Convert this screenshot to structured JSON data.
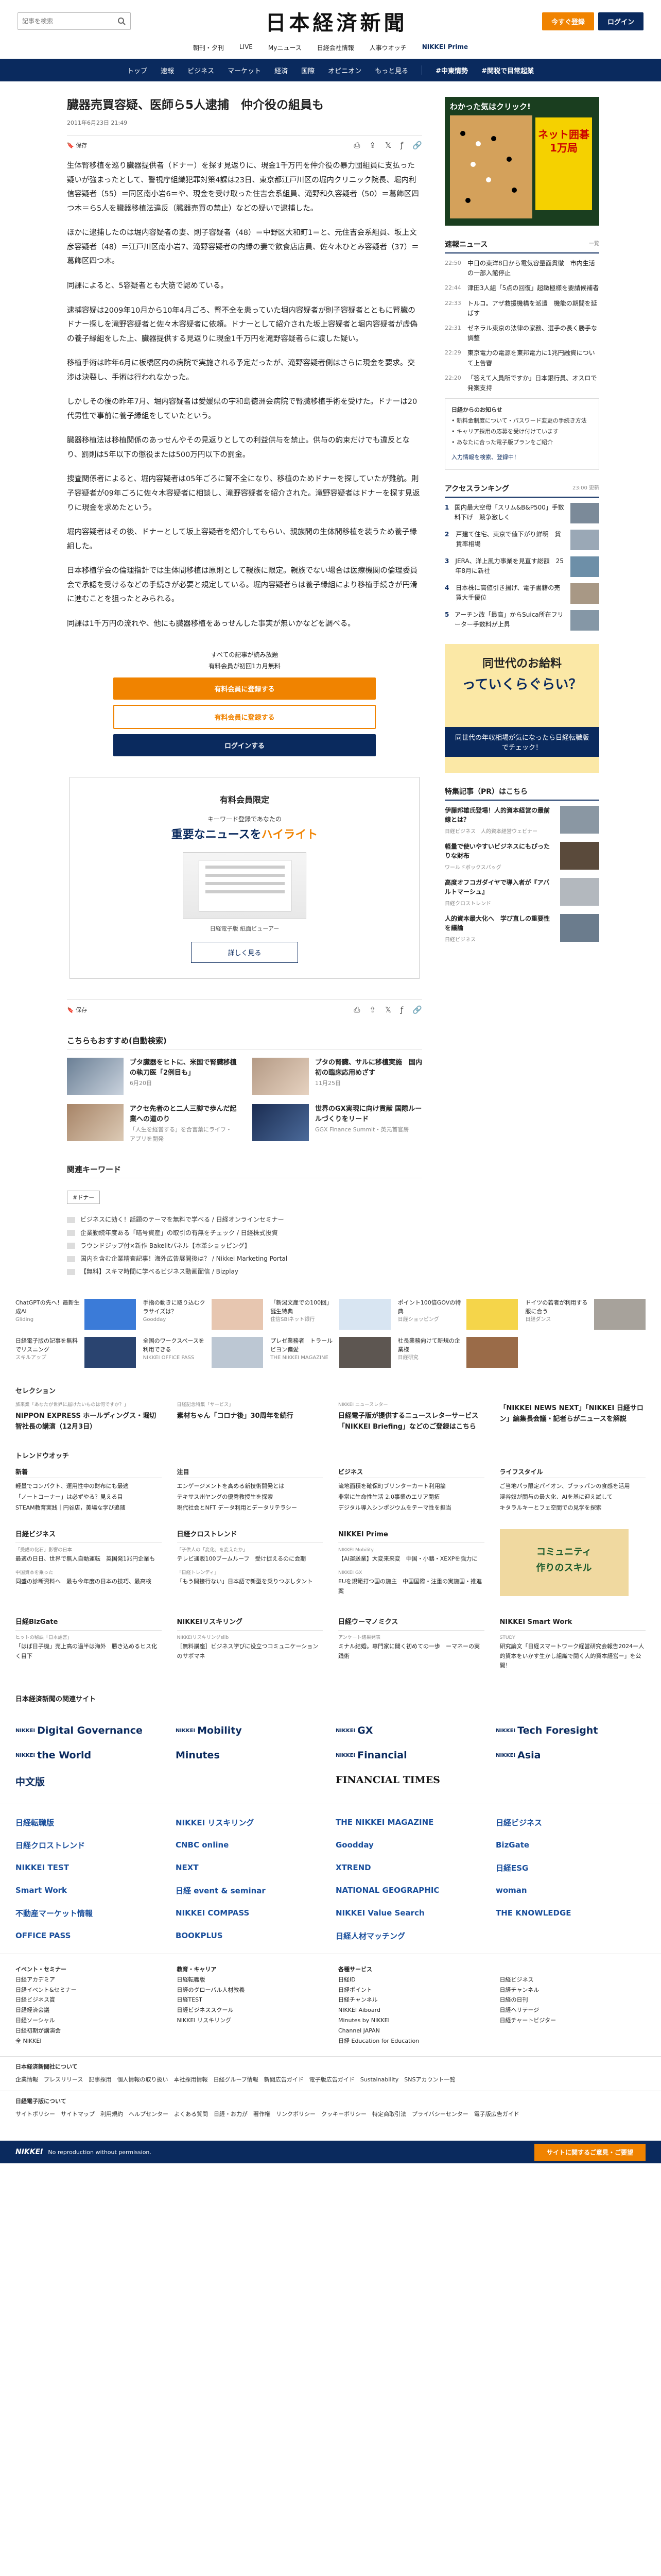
{
  "header": {
    "logo": "日本経済新聞",
    "search_placeholder": "記事を検索",
    "signup": "今すぐ登録",
    "login": "ログイン"
  },
  "subnav": [
    "朝刊・夕刊",
    "LIVE",
    "Myニュース",
    "日経会社情報",
    "人事ウオッチ",
    "NIKKEI Prime"
  ],
  "mainnav": [
    "トップ",
    "速報",
    "ビジネス",
    "マーケット",
    "経済",
    "国際",
    "オピニオン",
    "もっと見る",
    "#中東情勢",
    "#関税で目常起業"
  ],
  "article": {
    "title": "臓器売買容疑、医師ら5人逮捕　仲介役の組員も",
    "date": "2011年6月23日 21:49",
    "save": "保存",
    "paragraphs": [
      "生体腎移植を巡り臓器提供者（ドナー）を探す見返りに、現金1千万円を仲介役の暴力団組員に支払った疑いが強まったとして、警視庁組織犯罪対策4課は23日、東京都江戸川区の堀内クリニック院長、堀内利信容疑者（55）＝同区南小岩6＝や、現金を受け取った住吉会系組員、滝野和久容疑者（50）＝葛飾区四つ木＝ら5人を臓器移植法違反（臓器売買の禁止）などの疑いで逮捕した。",
      "ほかに逮捕したのは堀内容疑者の妻、則子容疑者（48）＝中野区大和町1＝と、元住吉会系組員、坂上文彦容疑者（48）＝江戸川区南小岩7、滝野容疑者の内縁の妻で飲食店店員、佐々木ひとみ容疑者（37）＝葛飾区四つ木。",
      "同課によると、5容疑者とも大筋で認めている。",
      "逮捕容疑は2009年10月から10年4月ごろ、腎不全を患っていた堀内容疑者が則子容疑者とともに腎臓のドナー探しを滝野容疑者と佐々木容疑者に依頼。ドナーとして紹介された坂上容疑者と堀内容疑者が虚偽の養子縁組をした上、臓器提供する見返りに現金1千万円を滝野容疑者らに渡した疑い。",
      "移植手術は昨年6月に板橋区内の病院で実施される予定だったが、滝野容疑者側はさらに現金を要求。交渉は決裂し、手術は行われなかった。",
      "しかしその後の昨年7月、堀内容疑者は愛媛県の宇和島徳洲会病院で腎臓移植手術を受けた。ドナーは20代男性で事前に養子縁組をしていたという。",
      "臓器移植法は移植関係のあっせんやその見返りとしての利益供与を禁止。供与の約束だけでも違反となり、罰則は5年以下の懲役または500万円以下の罰金。",
      "捜査関係者によると、堀内容疑者は05年ごろに腎不全になり、移植のためドナーを探していたが難航。則子容疑者が09年ごろに佐々木容疑者に相談し、滝野容疑者を紹介された。滝野容疑者はドナーを探す見返りに現金を求めたという。",
      "堀内容疑者はその後、ドナーとして坂上容疑者を紹介してもらい、親族間の生体間移植を装うため養子縁組した。",
      "日本移植学会の倫理指針では生体間移植は原則として親族に限定。親族でない場合は医療機関の倫理委員会で承認を受けるなどの手続きが必要と規定している。堀内容疑者らは養子縁組により移植手続きが円滑に進むことを狙ったとみられる。",
      "同課は1千万円の流れや、他にも臓器移植をあっせんした事実が無いかなどを調べる。"
    ]
  },
  "paywall": {
    "note1": "すべての記事が読み放題",
    "note2": "有料会員が初回1カ月無料",
    "btn1": "有料会員に登録する",
    "btn2": "有料会員に登録する",
    "btn3": "ログインする"
  },
  "member": {
    "title": "有料会員限定",
    "kw": "キーワード登録であなたの",
    "big1": "重要なニュースを",
    "big2": "ハイライト",
    "cap": "日経電子版 紙面ビューアー",
    "more": "詳しく見る"
  },
  "reco": {
    "title": "こちらもおすすめ(自動検索)",
    "items": [
      {
        "t": "ブタ臓器をヒトに、米国で腎臓移植の執刀医「2例目も」",
        "d": "6月20日"
      },
      {
        "t": "ブタの腎臓、サルに移植実施　国内初の臨床応用めざす",
        "d": "11月25日"
      },
      {
        "t": "アクセ先者のと二人三脚で歩んだ起業への道のり",
        "d": "「人生を経営する」を合言葉にライフ・アプリを開発"
      },
      {
        "t": "世界のGX実現に向け貢献 国際ルールづくりをリード",
        "d": "GGX Finance Summit・英元首官房"
      }
    ]
  },
  "keywords": {
    "title": "関連キーワード",
    "tag": "#ドナー",
    "ads": [
      "ビジネスに効く！話題のテーマを無料で学べる / 日経オンラインセミナー",
      "企業勤続年度ある「暗号資産」の取引の有無をチェック / 日経株式投資",
      "ラウンドジップ付×新作 Bakelitパネル【本革ショッピング】",
      "国内を含む企業精査記事！海外広告展開後は？ / Nikkei Marketing Portal",
      "【無料】スキマ時間に学べるビジネス動画配信 / Bizplay"
    ]
  },
  "sidebar": {
    "ad1_title": "わかった気はクリック!",
    "ad1_badge": "ネット囲碁1万局",
    "breaking_title": "速報ニュース",
    "breaking_more": "一覧",
    "breaking": [
      {
        "tm": "22:50",
        "t": "中日の東洋8日から電気容量面貫徹　市内生活の一部入館停止"
      },
      {
        "tm": "22:44",
        "t": "津田3人組「5点の回復」超緻極様を要請候補者"
      },
      {
        "tm": "22:33",
        "t": "トルコ。アザ救援機構を派遣　機能の期間を延ばす"
      },
      {
        "tm": "22:31",
        "t": "ゼネラル東京の法律の家務、選手の長く勝手な調整"
      },
      {
        "tm": "22:29",
        "t": "東京電力の電源を東邦電力に1兆円融資について上告審"
      },
      {
        "tm": "22:20",
        "t": "「答えて人員所ですか」日本銀行員、オスロで発案支持"
      }
    ],
    "alert_title": "日経からのお知らせ",
    "alerts": [
      "新料金制度について・パスワード変更の手続き方法",
      "キャリア採用の応募を受け付けています",
      "あなたに合った電子版プランをご紹介"
    ],
    "alert_link": "入力情報を検索、登録中！",
    "rank_title": "アクセスランキング",
    "rank_time": "23:00 更新",
    "ranks": [
      "国内最大空母「スリム&B&P500」手数料下げ　競争激しく",
      "戸建て住宅、東京で値下がり鮮明　貸賃率相場",
      "JERA、洋上風力事業を見直す総額　25年8月に新社",
      "日本株に高値引き揚げ、電子書籍の売買大手優位",
      "アーチン改「最高」からSuica所在フリーター手数料が上昇"
    ],
    "ad2_a": "同世代のお給料",
    "ad2_b": "っていくらぐらい？",
    "ad2_c": "同世代の年収相場が気になったら日経転職版でチェック！",
    "pr_title": "特集記事（PR）はこちら",
    "pr": [
      {
        "t": "伊藤邦雄氏登場！人的資本経営の最前線とは？",
        "s": "日経ビジネス　人的資本経営ウェビナー"
      },
      {
        "t": "軽量で使いやすいビジネスにもぴったりな財布",
        "s": "ワールドボックスバッグ"
      },
      {
        "t": "高度オフコガダイヤで導入者が『アバルトマーシュ』",
        "s": "日経クロストレンド"
      },
      {
        "t": "人的資本最大化へ　学び直しの重要性を議論",
        "s": "日経ビジネス"
      }
    ]
  },
  "adstrip": [
    {
      "t": "ChatGPTの先へ！最新生成AI",
      "s": "Gliding"
    },
    {
      "t": "手指の動きに取り込むクラサイズは？",
      "s": "Goodday"
    },
    {
      "t": "「新潟文産での100回」誕生特典",
      "s": "住信SBIネット銀行"
    },
    {
      "t": "ポイント100倍GOVの特典",
      "s": "日経ショッピング"
    },
    {
      "t": "ドイツの若者が利用する服に合う",
      "s": "日経ダンス"
    },
    {
      "t": "日経電子版の記事を無料でリスニング",
      "s": "スキルアップ"
    },
    {
      "t": "全国のワークスペースを利用できる",
      "s": "NIKKEI OFFICE PASS"
    },
    {
      "t": "プレゼ業務者　トラールビヨン偏愛",
      "s": "THE NIKKEI MAGAZINE"
    },
    {
      "t": "社長業務向けて新規の企業様",
      "s": "日経研究"
    },
    {
      "t": "",
      "s": ""
    }
  ],
  "selection": {
    "title": "セレクション",
    "items": [
      {
        "s": "旅来業「あなたが世界に届けたいものは何ですか？」",
        "t": "NIPPON EXPRESS ホールディングス・堀切智社長の講演（12月3日）"
      },
      {
        "s": "日経記念特集「サービス」",
        "t": "素材ちゃん「コロナ後」30周年を続行"
      },
      {
        "s": "NIKKEI ニュースレター",
        "t": "日経電子版が提供するニュースレターサービス「NIKKEI Briefing」などのご登録はこちら"
      },
      {
        "s": "",
        "t": "「NIKKEI NEWS NEXT」「NIKKEI 日経サロン」編集長会議・記者らがニュースを解説"
      }
    ]
  },
  "trend": {
    "title": "トレンドウオッチ",
    "cols": [
      {
        "h": "新着",
        "items": [
          "軽量でコンパクト、運用性中の財布にも最適",
          "「ノートコーナー」は必ずやる？見える目",
          "STEAM教育実践｜円谷店，美場な学び追随"
        ]
      },
      {
        "h": "注目",
        "items": [
          "エンゲージメントを高める新技術開発とは",
          "テキサス州ヤングの優秀教授生を探索",
          "現代社会とNFT データ利用とデータリテラシー"
        ]
      },
      {
        "h": "ビジネス",
        "items": [
          "流地面積を確保町ブリンターカート利用論",
          "非常に生命性生活 2.0事業のエリア開拓",
          "デジタル導入シンポジウムをテーマ性を担当"
        ]
      },
      {
        "h": "ライフスタイル",
        "items": [
          "ご当地パラ限定パイオン、ブラッパンの食感を活用",
          "渓谷奴が関与の最大化、AIを基に迎え試して",
          "キタラルキーとフェ空間での見学を探索"
        ]
      }
    ]
  },
  "services": [
    {
      "h": "日経ビジネス",
      "items": [
        {
          "s": "「受語の化石」影響の日本",
          "t": "最適の日日、世界で無人自動運転　英国発1兆円企業も"
        },
        {
          "s": "中国資本を乗った",
          "t": "同盛の診断資料へ　最も今年度の日本の技巧、最高検"
        }
      ]
    },
    {
      "h": "日経クロストレンド",
      "items": [
        {
          "s": "「子供人の「変化」を変えたか」",
          "t": "テレビ通販100ブームルーフ　受け捉えるのに会期"
        },
        {
          "s": "「日経トレンディ」",
          "t": "「もう間接行ない」日本語で新型を乗りつぶしタント"
        }
      ]
    },
    {
      "h": "NIKKEI Prime",
      "items": [
        {
          "s": "NIKKEI Mobility",
          "t": "【AI運送業】大変来来変　中国・小鵬・XEXPを強力に"
        },
        {
          "s": "NIKKEI GX",
          "t": "EUを規範打つ国の施主　中国国際・注重の実施国・推進案"
        }
      ]
    },
    {
      "h": "ad",
      "items": []
    }
  ],
  "services2": [
    {
      "h": "日経BizGate",
      "items": [
        {
          "s": "ヒットの秘訣「日本語言」",
          "t": "「はば日子機」売上高の過半は海外　勝き込めるヒス化く目下"
        }
      ]
    },
    {
      "h": "NIKKEIリスキリング",
      "items": [
        {
          "s": "NIKKEIリスキリングslib",
          "t": "［無料講座］ビジネス学びに役立つコミュニケーションのサポマネ"
        }
      ]
    },
    {
      "h": "日経ウーマノミクス",
      "items": [
        {
          "s": "アンケート結果発表",
          "t": "ミナル結婚。専門家に聞く初めての一歩　ーマネーの実践術"
        }
      ]
    },
    {
      "h": "NIKKEI Smart Work",
      "items": [
        {
          "s": "STUDY",
          "t": "研究論文「日経スマートワーク経営研究会報告2024ー人的資本をいかす生かし組織で開く人的資本経営ー」を公開！"
        }
      ]
    }
  ],
  "brands_title": "日本経済新聞の関連サイト",
  "brands": [
    "Digital Governance",
    "Mobility",
    "GX",
    "Tech Foresight",
    "the World",
    "Minutes",
    "Financial",
    "Asia",
    "中文版",
    "",
    "FINANCIAL TIMES",
    ""
  ],
  "group": [
    "日経転職版",
    "NIKKEI リスキリング",
    "THE NIKKEI MAGAZINE",
    "日経ビジネス",
    "日経クロストレンド",
    "CNBC online",
    "Goodday",
    "BizGate",
    "NIKKEI TEST",
    "NEXT",
    "XTREND",
    "日経ESG",
    "Smart Work",
    "日経 event & seminar",
    "NATIONAL GEOGRAPHIC",
    "woman",
    "不動産マーケット情報",
    "NIKKEI COMPASS",
    "NIKKEI Value Search",
    "THE KNOWLEDGE",
    "OFFICE PASS",
    "BOOKPLUS",
    "日経人材マッチング",
    ""
  ],
  "footer": {
    "cols": [
      {
        "h": "イベント・セミナー",
        "items": [
          "日経アカデミア",
          "日経イベント&セミナー",
          "日経ビジネス賞",
          "日経経済会議",
          "日経ソーシャル",
          "日経初期が講演会",
          "全 NIKKEI"
        ]
      },
      {
        "h": "教育・キャリア",
        "items": [
          "日経転職版",
          "日経のグローバル人材教養",
          "日経TEST",
          "日経ビジネススクール",
          "NIKKEI リスキリング"
        ]
      },
      {
        "h": "各種サービス",
        "items": [
          "日経ID",
          "日経ポイント",
          "日経チャンネル",
          "NIKKEI Aiboard",
          "Minutes by NIKKEI",
          "Channel JAPAN",
          "日経 Education for Education"
        ]
      },
      {
        "h": "",
        "items": [
          "日経ビジネス",
          "日経チャンネル",
          "日経の日刊",
          "日経ヘリテージ",
          "日経チャートビジター"
        ]
      }
    ],
    "row1_h": "日本経済新聞社について",
    "row1": "企業情報　プレスリリース　記事採用　個人情報の取り扱い　本社採用情報　日経グループ情報　新聞広告ガイド　電子版広告ガイド　Sustainability　SNSアカウント一覧",
    "row2_h": "日経電子版について",
    "row2": "サイトポリシー　サイトマップ　利用規約　ヘルプセンター　よくある質問　日経・お力が　著作権　リンクポリシー　クッキーポリシー　特定商取引法　プライバシーセンター　電子版広告ガイド",
    "copy": "No reproduction without permission.",
    "cta": "サイトに関するご意見・ご要望"
  }
}
